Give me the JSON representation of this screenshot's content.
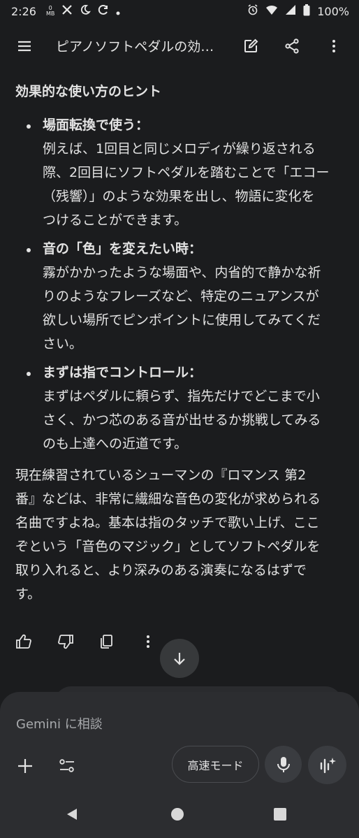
{
  "status_bar": {
    "time": "2:26",
    "data_top": "0",
    "data_bottom": "MB",
    "battery": "100%",
    "icons": [
      "x-icon",
      "moon-icon",
      "sync-icon",
      "dot-icon",
      "alarm-icon",
      "wifi-icon",
      "signal-icon",
      "battery-icon"
    ]
  },
  "app_bar": {
    "title": "ピアノソフトペダルの効…",
    "icons": [
      "menu-icon",
      "edit-icon",
      "share-icon",
      "more-vert-icon"
    ]
  },
  "response": {
    "heading": "効果的な使い方のヒント",
    "bullets": [
      {
        "label": "場面転換で使う：",
        "lines": [
          "例えば、1回目と同じメロディが繰り返される",
          "際、2回目にソフトペダルを踏むことで「エコー",
          "（残響）」のような効果を出し、物語に変化を",
          "つけることができます。"
        ]
      },
      {
        "label": "音の「色」を変えたい時：",
        "lines": [
          "霧がかかったような場面や、内省的で静かな祈",
          "りのようなフレーズなど、特定のニュアンスが",
          "欲しい場所でピンポイントに使用してみてくだ",
          "さい。"
        ]
      },
      {
        "label": "まずは指でコントロール：",
        "lines": [
          "まずはペダルに頼らず、指先だけでどこまで小",
          "さく、かつ芯のある音が出せるか挑戦してみる",
          "のも上達への近道です。"
        ]
      }
    ],
    "closing_lines": [
      "現在練習されているシューマンの『ロマンス 第2",
      "番』などは、非常に繊細な音色の変化が求められる",
      "名曲ですよね。基本は指のタッチで歌い上げ、ここ",
      "ぞという「音色のマジック」としてソフトペダルを",
      "取り入れると、より深みのある演奏になるはずで",
      "す。"
    ]
  },
  "actions": [
    "thumb-up-icon",
    "thumb-down-icon",
    "copy-icon",
    "more-vert-icon"
  ],
  "composer": {
    "placeholder": "Gemini に相談",
    "mode_label": "高速モード"
  },
  "colors": {
    "background": "#1b1c1e",
    "surface": "#2c2d30",
    "text": "#e3e3e3",
    "muted": "#a8aaad"
  }
}
